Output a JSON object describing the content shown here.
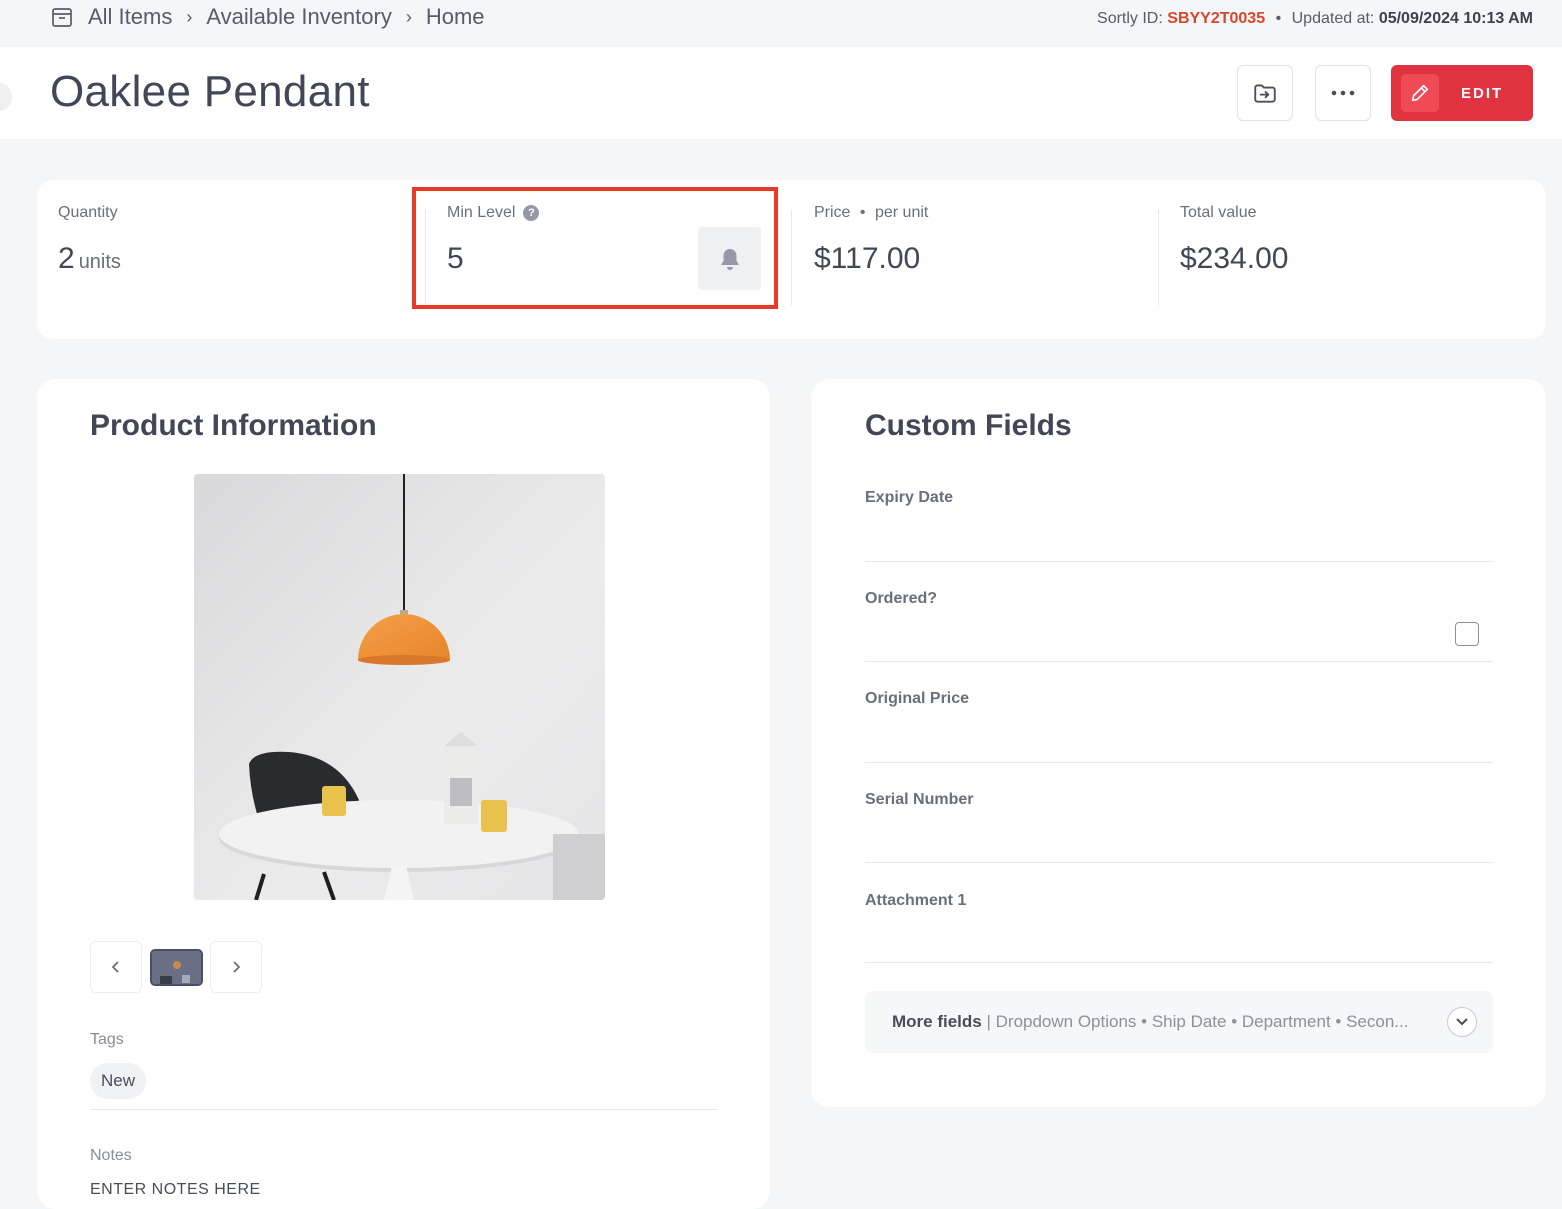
{
  "breadcrumb": {
    "items": [
      "All Items",
      "Available Inventory",
      "Home"
    ]
  },
  "meta": {
    "sortly_label": "Sortly ID:",
    "sortly_id": "SBYY2T0035",
    "updated_label": "Updated at:",
    "updated_value": "05/09/2024 10:13 AM"
  },
  "header": {
    "title": "Oaklee Pendant",
    "edit_label": "EDIT"
  },
  "stats": {
    "quantity_label": "Quantity",
    "quantity_value": "2",
    "quantity_unit": "units",
    "min_level_label": "Min Level",
    "min_level_value": "5",
    "price_label": "Price",
    "price_suffix": "per unit",
    "price_value": "$117.00",
    "total_label": "Total value",
    "total_value": "$234.00"
  },
  "product": {
    "title": "Product Information",
    "tags_label": "Tags",
    "tags": [
      "New"
    ],
    "notes_label": "Notes",
    "notes_value": "ENTER NOTES HERE"
  },
  "custom_fields": {
    "title": "Custom Fields",
    "fields": [
      {
        "label": "Expiry Date"
      },
      {
        "label": "Ordered?"
      },
      {
        "label": "Original Price"
      },
      {
        "label": "Serial Number"
      },
      {
        "label": "Attachment 1"
      }
    ],
    "ordered_checked": false,
    "more_label": "More fields",
    "more_list": "Dropdown Options • Ship Date • Department • Secon..."
  },
  "colors": {
    "accent": "#e1323f",
    "highlight": "#e83a26",
    "sortly_id": "#d9472b"
  }
}
